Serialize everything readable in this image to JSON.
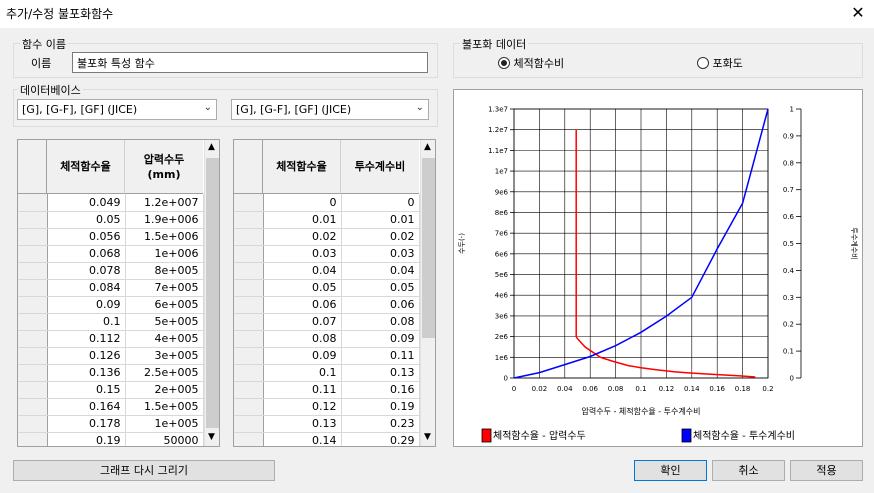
{
  "window": {
    "title": "추가/수정 불포화함수",
    "close": "✕"
  },
  "func_group": {
    "label": "함수 이름",
    "name_label": "이름",
    "name_value": "불포화 특성 함수"
  },
  "db_group": {
    "label": "데이터베이스",
    "combo1": "[G], [G-F], [GF] (JICE)",
    "combo2": "[G], [G-F], [GF] (JICE)"
  },
  "table1": {
    "col1": "체적함수율",
    "col2": "압력수두\n(mm)",
    "rows": [
      [
        "0.049",
        "1.2e+007"
      ],
      [
        "0.05",
        "1.9e+006"
      ],
      [
        "0.056",
        "1.5e+006"
      ],
      [
        "0.068",
        "1e+006"
      ],
      [
        "0.078",
        "8e+005"
      ],
      [
        "0.084",
        "7e+005"
      ],
      [
        "0.09",
        "6e+005"
      ],
      [
        "0.1",
        "5e+005"
      ],
      [
        "0.112",
        "4e+005"
      ],
      [
        "0.126",
        "3e+005"
      ],
      [
        "0.136",
        "2.5e+005"
      ],
      [
        "0.15",
        "2e+005"
      ],
      [
        "0.164",
        "1.5e+005"
      ],
      [
        "0.178",
        "1e+005"
      ],
      [
        "0.19",
        "50000"
      ]
    ]
  },
  "table2": {
    "col1": "체적함수율",
    "col2": "투수계수비",
    "rows": [
      [
        "0",
        "0"
      ],
      [
        "0.01",
        "0.01"
      ],
      [
        "0.02",
        "0.02"
      ],
      [
        "0.03",
        "0.03"
      ],
      [
        "0.04",
        "0.04"
      ],
      [
        "0.05",
        "0.05"
      ],
      [
        "0.06",
        "0.06"
      ],
      [
        "0.07",
        "0.08"
      ],
      [
        "0.08",
        "0.09"
      ],
      [
        "0.09",
        "0.11"
      ],
      [
        "0.1",
        "0.13"
      ],
      [
        "0.11",
        "0.16"
      ],
      [
        "0.12",
        "0.19"
      ],
      [
        "0.13",
        "0.23"
      ],
      [
        "0.14",
        "0.29"
      ]
    ]
  },
  "redraw_button": "그래프 다시 그리기",
  "unsat_group": {
    "label": "불포화 데이터",
    "radio1": "체적함수비",
    "radio2": "포화도",
    "selected": "radio1"
  },
  "buttons": {
    "ok": "확인",
    "cancel": "취소",
    "apply": "적용"
  },
  "chart_data": {
    "type": "line",
    "xlabel": "압력수두 - 체적함수율 - 투수계수비",
    "ylabel_left": "수두(-)",
    "ylabel_right": "투수계수비",
    "x_ticks": [
      "0",
      "0.02",
      "0.04",
      "0.06",
      "0.08",
      "0.1",
      "0.12",
      "0.14",
      "0.16",
      "0.18",
      "0.2"
    ],
    "xlim": [
      0,
      0.2
    ],
    "y_left_ticks": [
      "0",
      "1e6",
      "2e6",
      "3e6",
      "4e6",
      "5e6",
      "6e6",
      "7e6",
      "8e6",
      "9e6",
      "1e7",
      "1.1e7",
      "1.2e7",
      "1.3e7"
    ],
    "ylim_left": [
      0,
      13000000
    ],
    "y_right_ticks": [
      "0",
      "0.1",
      "0.2",
      "0.3",
      "0.4",
      "0.5",
      "0.6",
      "0.7",
      "0.8",
      "0.9",
      "1"
    ],
    "ylim_right": [
      0,
      1
    ],
    "series": [
      {
        "name": "체적함수율 - 압력수두",
        "color": "#ff0000",
        "axis": "left",
        "x": [
          0.049,
          0.049,
          0.05,
          0.056,
          0.068,
          0.078,
          0.084,
          0.09,
          0.1,
          0.112,
          0.126,
          0.136,
          0.15,
          0.164,
          0.178,
          0.19
        ],
        "y": [
          12000000,
          2000000,
          1900000,
          1500000,
          1000000,
          800000,
          700000,
          600000,
          500000,
          400000,
          300000,
          250000,
          200000,
          150000,
          100000,
          50000
        ]
      },
      {
        "name": "체적함수율 - 투수계수비",
        "color": "#0000ff",
        "axis": "right",
        "x": [
          0,
          0.02,
          0.04,
          0.06,
          0.08,
          0.1,
          0.12,
          0.14,
          0.16,
          0.18,
          0.2
        ],
        "y": [
          0,
          0.02,
          0.05,
          0.08,
          0.12,
          0.17,
          0.23,
          0.3,
          0.48,
          0.65,
          1.0
        ]
      }
    ]
  }
}
